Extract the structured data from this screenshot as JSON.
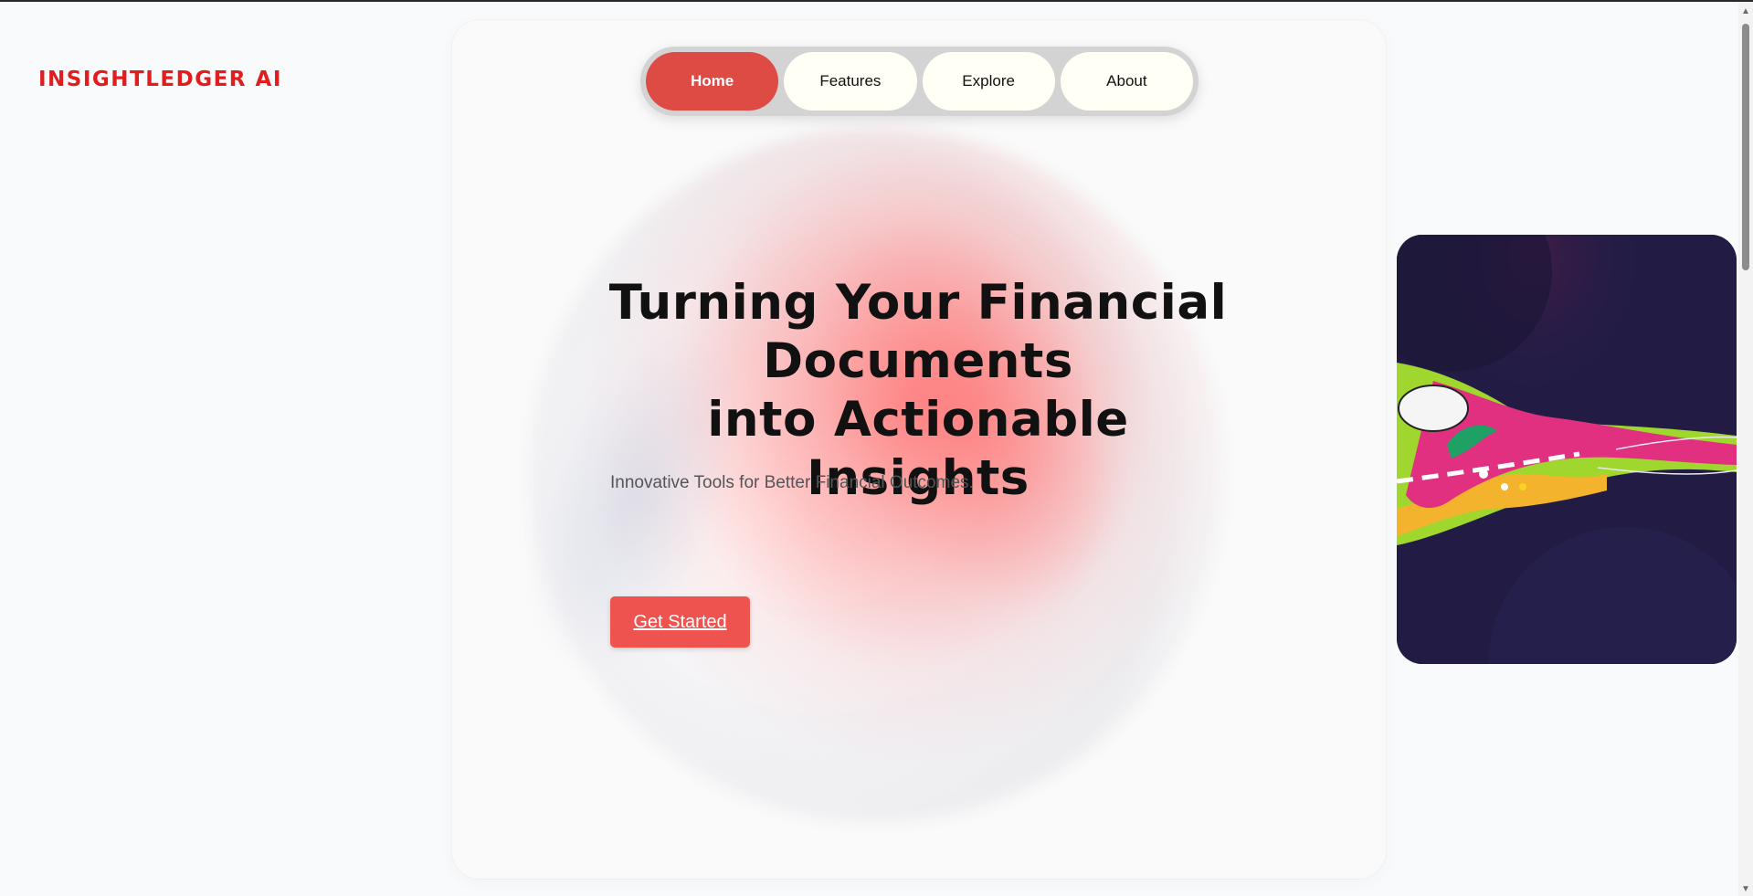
{
  "brand": {
    "name": "INSIGHTLEDGER AI",
    "color": "#e11d1d"
  },
  "nav": {
    "items": [
      {
        "label": "Home",
        "active": true
      },
      {
        "label": "Features",
        "active": false
      },
      {
        "label": "Explore",
        "active": false
      },
      {
        "label": "About",
        "active": false
      }
    ],
    "active_color": "#de4b44",
    "inactive_color": "#fffff5"
  },
  "hero": {
    "headline_lines": [
      "Turning Your Financial",
      "Documents",
      "into Actionable Insights"
    ],
    "subtitle": "Innovative Tools for Better Financial Outcomes.",
    "cta_label": "Get Started",
    "cta_color": "#ef5350"
  },
  "media": {
    "icon": "abstract-animation-graphic",
    "background_color": "#221c45"
  },
  "scrollbar": {
    "up_icon": "arrow-up-icon",
    "down_icon": "arrow-down-icon"
  }
}
